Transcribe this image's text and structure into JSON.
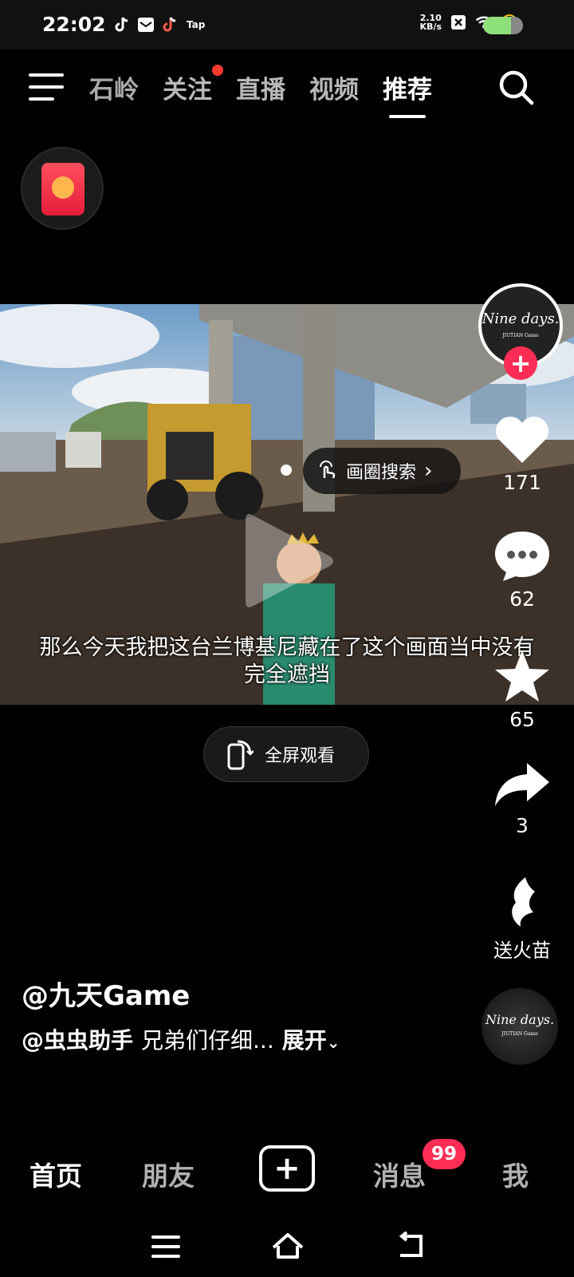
{
  "status_bar": {
    "time": "22:02",
    "tap_label": "Tap",
    "net_speed_value": "2.10",
    "net_speed_unit": "KB/s",
    "battery_level": 0.7,
    "icons": [
      "tiktok-icon",
      "mail-icon",
      "tiktok-lite-icon",
      "taptap-icon",
      "close-x-icon",
      "wifi-icon",
      "charging-icon",
      "battery-icon"
    ]
  },
  "top_nav": {
    "tabs": [
      {
        "label": "石岭",
        "partial": true
      },
      {
        "label": "关注",
        "dot": true
      },
      {
        "label": "直播"
      },
      {
        "label": "视频"
      },
      {
        "label": "推荐",
        "active": true
      }
    ]
  },
  "video": {
    "circle_search_label": "画圈搜索",
    "subtitle_line1": "那么今天我把这台兰博基尼藏在了这个画面当中没有",
    "subtitle_line2": "完全遮挡",
    "fullscreen_label": "全屏观看"
  },
  "rail": {
    "avatar_text": "Nine days.",
    "avatar_subtext": "JIUTIAN Game",
    "likes": "171",
    "comments": "62",
    "favorites": "65",
    "shares": "3",
    "gift_label": "送火苗"
  },
  "caption": {
    "author": "@九天Game",
    "mention": "@虫虫助手",
    "text": "兄弟们仔细...",
    "expand": "展开"
  },
  "bottom_nav": {
    "home": "首页",
    "friends": "朋友",
    "messages": "消息",
    "badge": "99",
    "me": "我"
  },
  "colors": {
    "accent": "#ff2d55",
    "background": "#000000"
  }
}
